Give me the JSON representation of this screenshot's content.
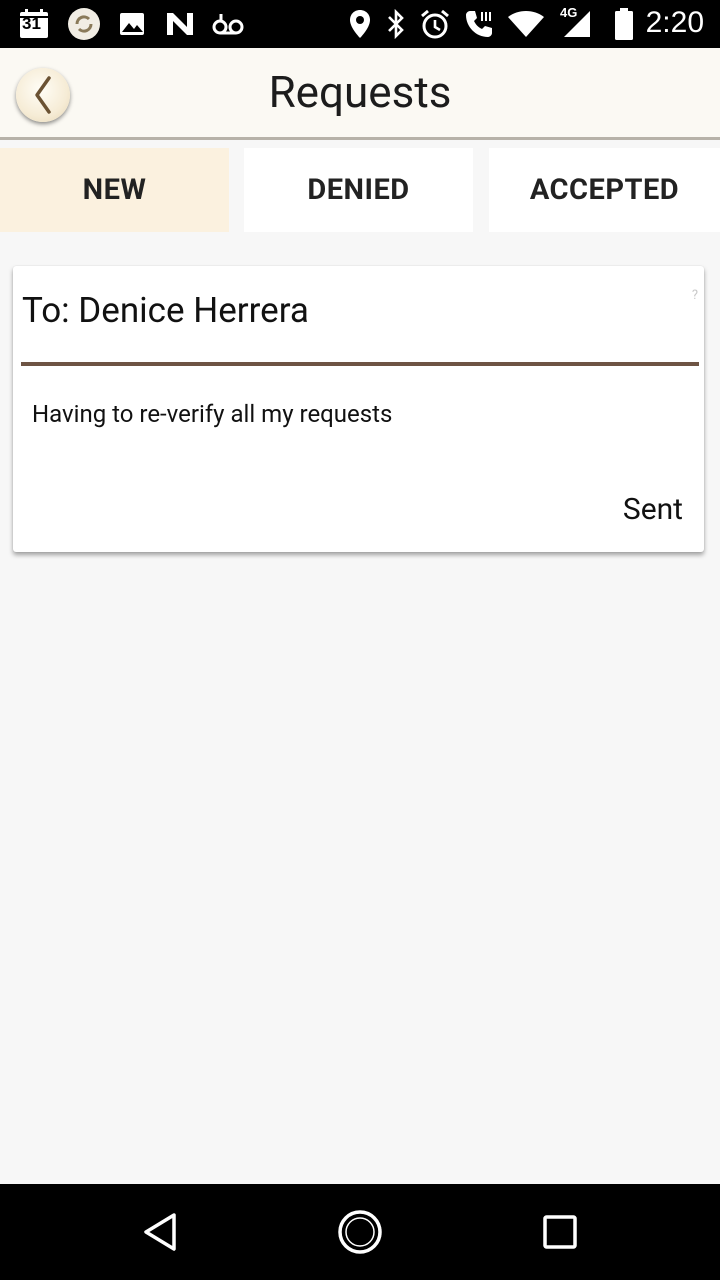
{
  "status_bar": {
    "time": "2:20",
    "network": "4G",
    "calendar_date": "31",
    "icons": [
      "calendar-icon",
      "sync-app-icon",
      "image-icon",
      "n-app-icon",
      "voicemail-icon",
      "location-icon",
      "bluetooth-icon",
      "alarm-icon",
      "call-icon",
      "wifi-icon",
      "signal-icon",
      "battery-icon"
    ]
  },
  "header": {
    "title": "Requests",
    "back_icon": "chevron-left-icon"
  },
  "tabs": [
    {
      "label": "NEW",
      "active": true
    },
    {
      "label": "DENIED",
      "active": false
    },
    {
      "label": "ACCEPTED",
      "active": false
    }
  ],
  "requests": [
    {
      "to": "To: Denice Herrera",
      "help": "?",
      "message": "Having to re-verify all my requests",
      "status": "Sent"
    }
  ],
  "colors": {
    "active_tab": "#fbf1df",
    "divider": "#6e5444",
    "app_bar": "#fbf9f3"
  },
  "nav_bar": {
    "icons": [
      "back-triangle-icon",
      "home-circle-icon",
      "recents-square-icon"
    ]
  }
}
